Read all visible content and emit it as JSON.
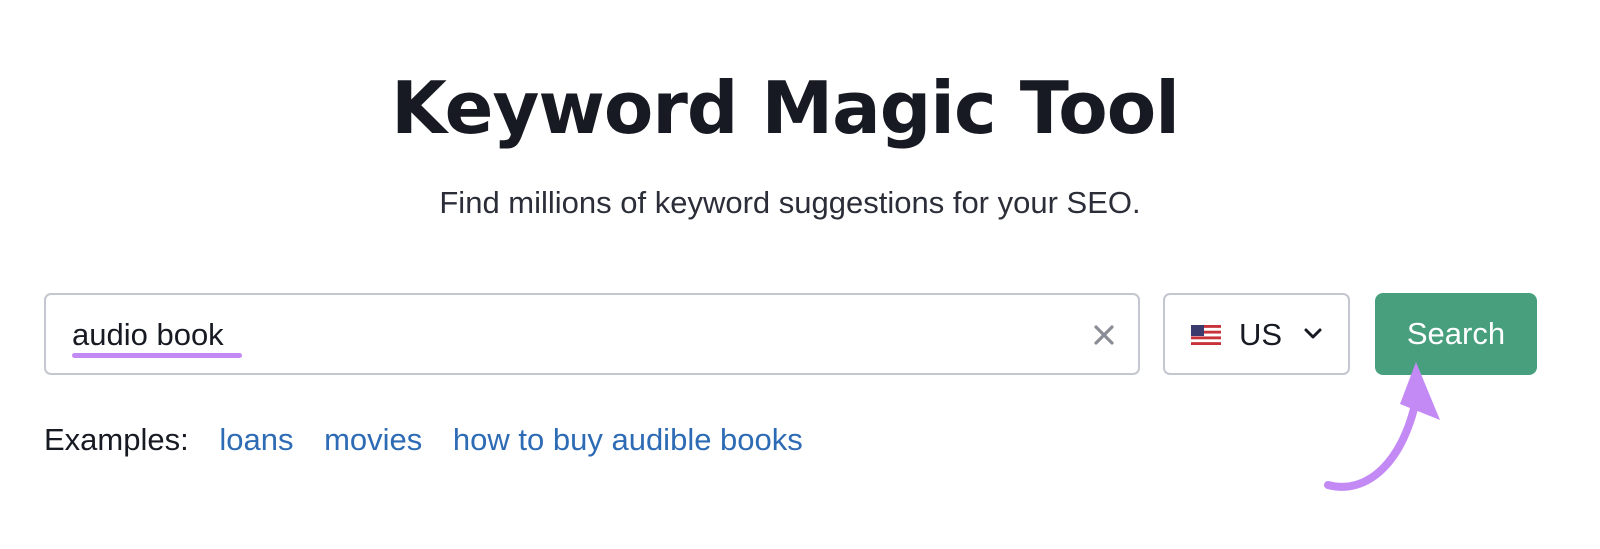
{
  "header": {
    "title": "Keyword Magic Tool",
    "subtitle": "Find millions of keyword suggestions for your SEO."
  },
  "search": {
    "value": "audio book",
    "clear_icon": "close-icon",
    "country": {
      "flag_icon": "us-flag-icon",
      "label": "US",
      "dropdown_icon": "chevron-down-icon"
    },
    "button_label": "Search",
    "button_color": "#479f7e"
  },
  "examples": {
    "label": "Examples:",
    "links": [
      "loans",
      "movies",
      "how to buy audible books"
    ],
    "link_color": "#2e6bb5"
  },
  "annotations": {
    "highlight_color": "#c38af6",
    "arrow_icon": "curved-arrow-icon"
  }
}
